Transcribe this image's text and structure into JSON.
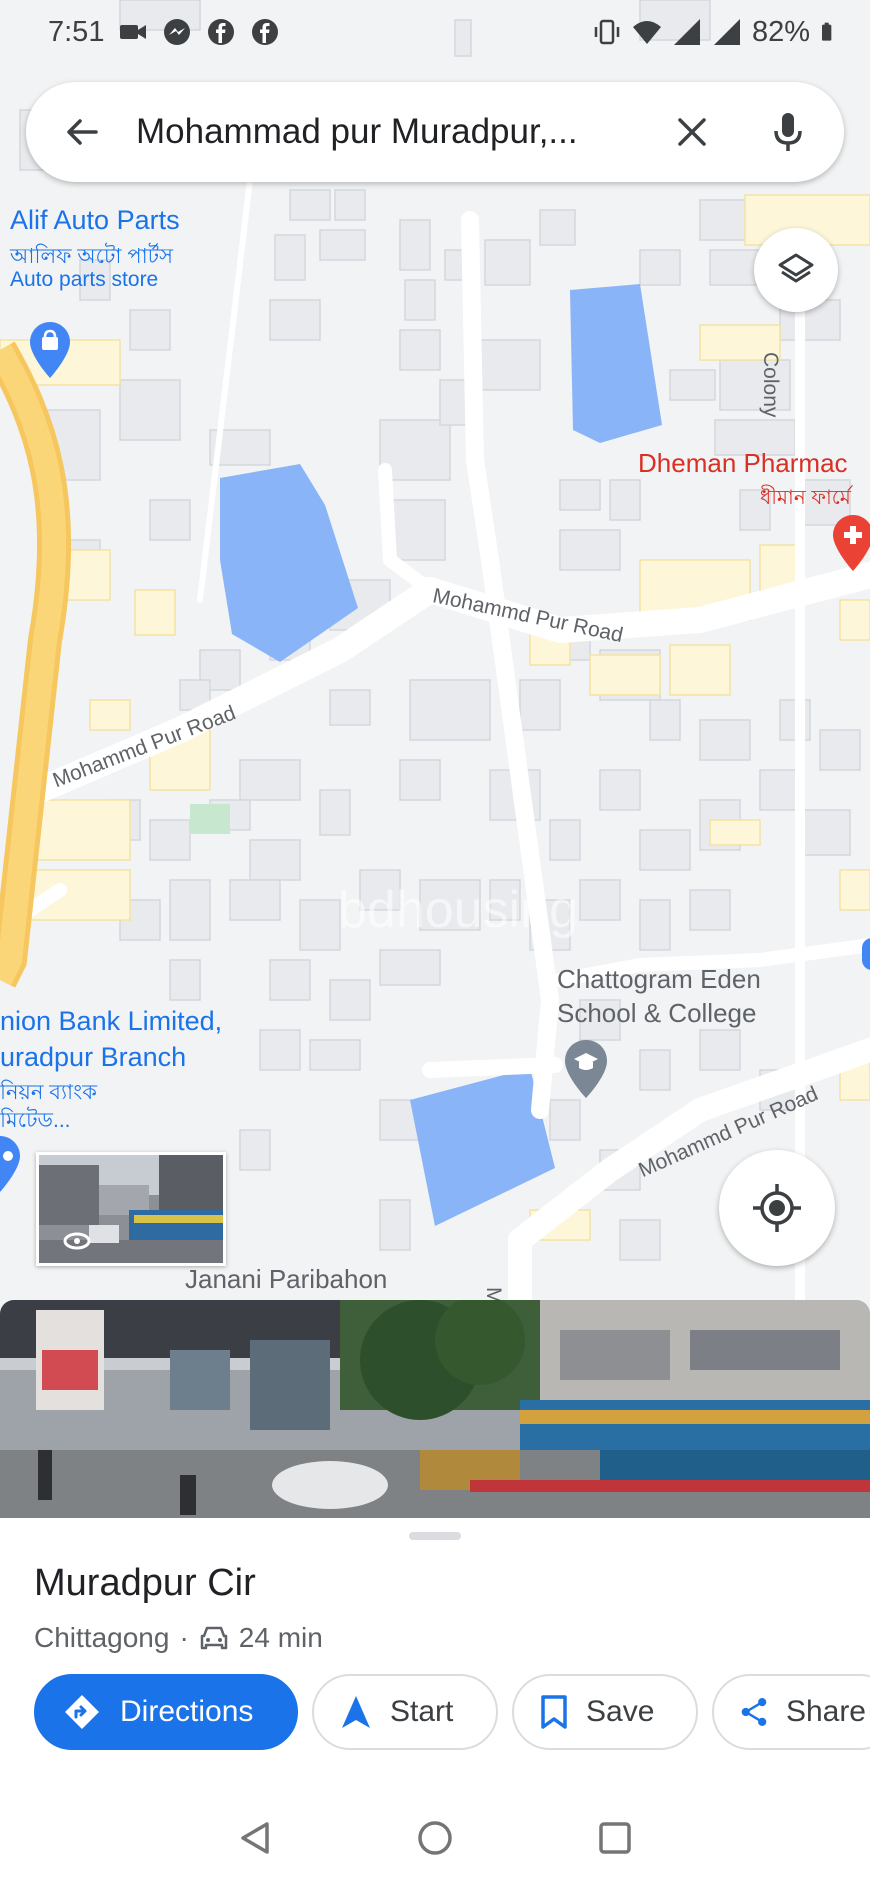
{
  "status_bar": {
    "time": "7:51",
    "battery": "82%",
    "left_icons": [
      "video-camera-icon",
      "messenger-icon",
      "facebook-icon",
      "facebook-icon"
    ],
    "right_icons": [
      "vibrate-icon",
      "wifi-icon",
      "signal-icon",
      "signal-icon",
      "battery-icon"
    ]
  },
  "search": {
    "query": "Mohammad pur Muradpur,...",
    "back_icon": "arrow-back-icon",
    "clear_icon": "close-icon",
    "mic_icon": "mic-icon"
  },
  "map": {
    "pois": {
      "alif_title": "Alif Auto Parts",
      "alif_bn": "আলিফ অটো পার্টস",
      "alif_type": "Auto parts store",
      "dheman_title": "Dheman Pharmac",
      "dheman_bn": "ধীমান ফার্মে",
      "school_line1": "Chattogram Eden",
      "school_line2": "School & College",
      "bank_line1": "nion Bank Limited,",
      "bank_line2": "uradpur Branch",
      "bank_bn1": "নিয়ন ব্যাংক",
      "bank_bn2": "মিটেড...",
      "janani": "Janani Paribahon"
    },
    "roads": {
      "road_1": "Mohammd Pur Road",
      "road_2": "Mohammd Pur Road",
      "road_3": "Mohammd Pur Road",
      "colony": "Colony",
      "moh": "Moh"
    },
    "watermark": "bdhousing"
  },
  "place": {
    "title": "Muradpur Cir",
    "city": "Chittagong",
    "separator": "·",
    "drive_time": "24 min"
  },
  "actions": {
    "directions": "Directions",
    "start": "Start",
    "save": "Save",
    "share": "Share"
  },
  "colors": {
    "accent": "#1a73e8",
    "water": "#8ab4f8",
    "highway": "#fbc04a",
    "poi_red": "#d93025"
  }
}
